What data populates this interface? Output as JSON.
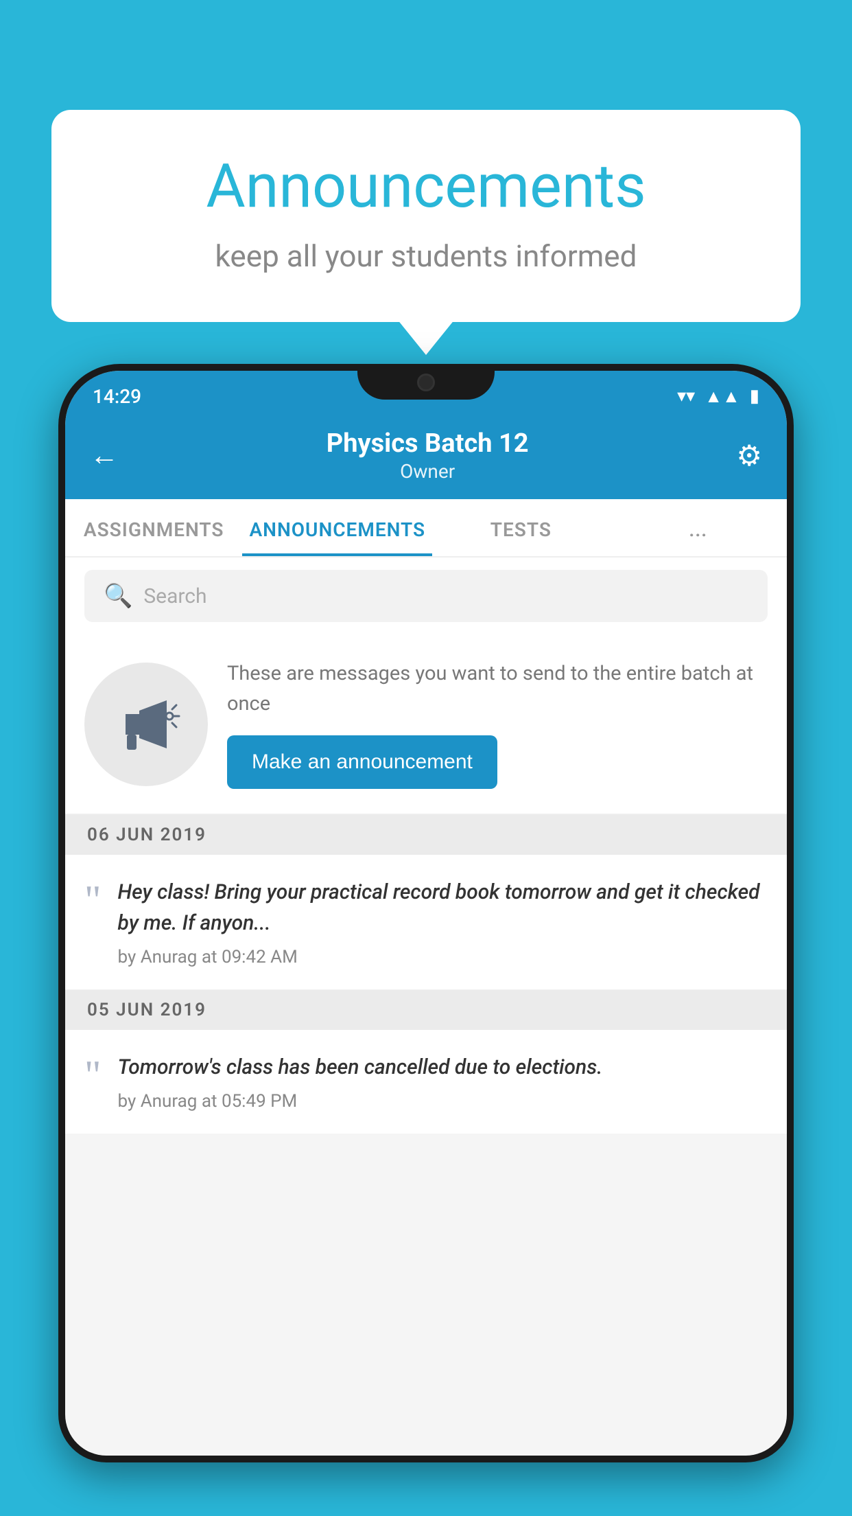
{
  "background_color": "#29b6d8",
  "speech_bubble": {
    "title": "Announcements",
    "subtitle": "keep all your students informed"
  },
  "phone": {
    "status_bar": {
      "time": "14:29",
      "icons": [
        "wifi",
        "signal",
        "battery"
      ]
    },
    "header": {
      "title": "Physics Batch 12",
      "subtitle": "Owner",
      "back_label": "←",
      "settings_label": "⚙"
    },
    "tabs": [
      {
        "label": "ASSIGNMENTS",
        "active": false
      },
      {
        "label": "ANNOUNCEMENTS",
        "active": true
      },
      {
        "label": "TESTS",
        "active": false
      },
      {
        "label": "...",
        "active": false
      }
    ],
    "search": {
      "placeholder": "Search"
    },
    "promo": {
      "description": "These are messages you want to send to the entire batch at once",
      "button_label": "Make an announcement"
    },
    "announcements": [
      {
        "date": "06  JUN  2019",
        "text": "Hey class! Bring your practical record book tomorrow and get it checked by me. If anyon...",
        "meta": "by Anurag at 09:42 AM"
      },
      {
        "date": "05  JUN  2019",
        "text": "Tomorrow's class has been cancelled due to elections.",
        "meta": "by Anurag at 05:49 PM"
      }
    ]
  }
}
